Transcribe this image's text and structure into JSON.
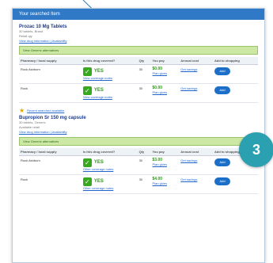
{
  "header": {
    "title": "Your searched Item"
  },
  "item1": {
    "title": "Prozac 10 Mg Tablets",
    "sub1": "30 tablets, Brand",
    "sub2": "Retail qty",
    "link": "View drug information | Availability",
    "greenbar": "View Generic alternatives",
    "table": {
      "headers": [
        "Pharmacy / local supply",
        "Is this drug covered?",
        "Qty",
        "You pay",
        "Annual cost",
        "Add to shopping"
      ],
      "rows": [
        {
          "pharmacy": "Rock Ashburn",
          "yes": "YES",
          "yes_note": "View coverage notes",
          "qty": "30",
          "price": "$0.00",
          "price_note": "Plan gives",
          "annual": "Get savings",
          "btn": "Add"
        },
        {
          "pharmacy": "Rock",
          "yes": "YES",
          "yes_note": "View coverage notes",
          "qty": "30",
          "price": "$0.00",
          "price_note": "Plan gives",
          "annual": "Get savings",
          "btn": "Add"
        }
      ]
    }
  },
  "item2": {
    "star_text": "Recent searched available",
    "title": "Bupropion Sr 150 mg capsule",
    "sub1": "30 tablets, Generic",
    "sub2": "Available retail",
    "link": "View drug information | Availability",
    "greenbar": "View Generic alternatives",
    "table": {
      "headers": [
        "Pharmacy / local supply",
        "Is this drug covered?",
        "Qty",
        "You pay",
        "Annual cost",
        "Add to shopping"
      ],
      "rows": [
        {
          "pharmacy": "Rock Ashburn",
          "yes": "YES",
          "yes_note": "Other coverage notes",
          "qty": "30",
          "price": "$3.00",
          "price_note": "Plan gives",
          "annual": "Get savings",
          "btn": "Add"
        },
        {
          "pharmacy": "Rock",
          "yes": "YES",
          "yes_note": "Other coverage notes",
          "qty": "30",
          "price": "$4.00",
          "price_note": "Plan gives",
          "annual": "Get savings",
          "btn": "Add"
        }
      ]
    }
  },
  "badge": {
    "number": "3"
  }
}
